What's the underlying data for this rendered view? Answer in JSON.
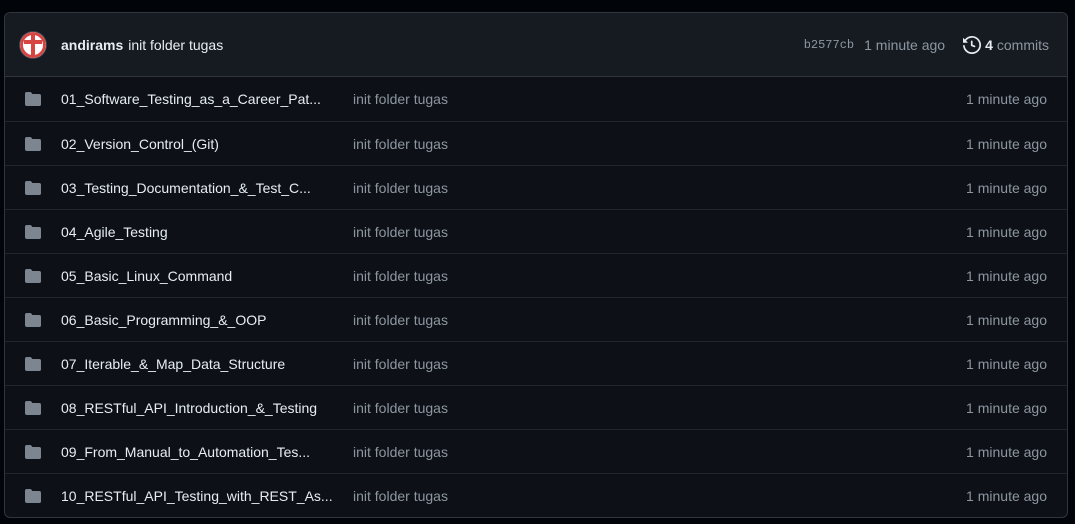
{
  "latest_commit": {
    "author": "andirams",
    "message": "init folder tugas",
    "sha": "b2577cb",
    "time": "1 minute ago",
    "commits_count": "4",
    "commits_label": "commits",
    "avatar_icon": "red-cross-avatar",
    "avatar_color": "#d64541"
  },
  "files": [
    {
      "name": "01_Software_Testing_as_a_Career_Pat...",
      "message": "init folder tugas",
      "time": "1 minute ago",
      "icon": "folder-icon"
    },
    {
      "name": "02_Version_Control_(Git)",
      "message": "init folder tugas",
      "time": "1 minute ago",
      "icon": "folder-icon"
    },
    {
      "name": "03_Testing_Documentation_&_Test_C...",
      "message": "init folder tugas",
      "time": "1 minute ago",
      "icon": "folder-icon"
    },
    {
      "name": "04_Agile_Testing",
      "message": "init folder tugas",
      "time": "1 minute ago",
      "icon": "folder-icon"
    },
    {
      "name": "05_Basic_Linux_Command",
      "message": "init folder tugas",
      "time": "1 minute ago",
      "icon": "folder-icon"
    },
    {
      "name": "06_Basic_Programming_&_OOP",
      "message": "init folder tugas",
      "time": "1 minute ago",
      "icon": "folder-icon"
    },
    {
      "name": "07_Iterable_&_Map_Data_Structure",
      "message": "init folder tugas",
      "time": "1 minute ago",
      "icon": "folder-icon"
    },
    {
      "name": "08_RESTful_API_Introduction_&_Testing",
      "message": "init folder tugas",
      "time": "1 minute ago",
      "icon": "folder-icon"
    },
    {
      "name": "09_From_Manual_to_Automation_Tes...",
      "message": "init folder tugas",
      "time": "1 minute ago",
      "icon": "folder-icon"
    },
    {
      "name": "10_RESTful_API_Testing_with_REST_As...",
      "message": "init folder tugas",
      "time": "1 minute ago",
      "icon": "folder-icon"
    }
  ],
  "colors": {
    "background": "#0d1117",
    "header_background": "#161b22",
    "border": "#30363d",
    "text_primary": "#e6edf3",
    "text_muted": "#8d96a0",
    "folder": "#7d8590"
  }
}
